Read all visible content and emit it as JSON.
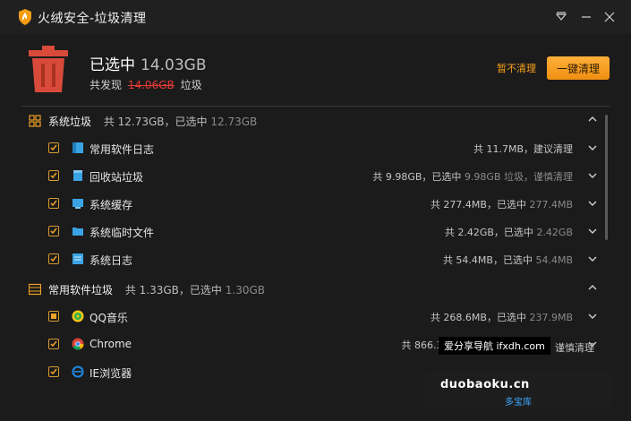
{
  "window": {
    "title": "火绒安全-垃圾清理",
    "buttons": [
      "dropdown-icon",
      "minimize-icon",
      "close-icon"
    ]
  },
  "summary": {
    "selected_prefix": "已选中",
    "selected_value": "14.03GB",
    "found_prefix": "共发现",
    "found_value": "14.06GB",
    "found_suffix": "垃圾",
    "cancel_label": "暂不清理",
    "clean_label": "一键清理"
  },
  "categories": [
    {
      "label": "系统垃圾",
      "summary": "共 12.73GB，已选中",
      "summary_hl": "12.73GB",
      "items": [
        {
          "label": "常用软件日志",
          "right": "共 11.7MB，建议清理",
          "hl": "",
          "checked": "full"
        },
        {
          "label": "回收站垃圾",
          "right": "共 9.98GB，已选中",
          "hl": "9.98GB 垃圾，谨慎清理",
          "checked": "full"
        },
        {
          "label": "系统缓存",
          "right": "共 277.4MB，已选中",
          "hl": "277.4MB",
          "checked": "full"
        },
        {
          "label": "系统临时文件",
          "right": "共 2.42GB，已选中",
          "hl": "2.42GB",
          "checked": "full"
        },
        {
          "label": "系统日志",
          "right": "共 54.4MB，已选中",
          "hl": "54.4MB",
          "checked": "full"
        }
      ]
    },
    {
      "label": "常用软件垃圾",
      "summary": "共 1.33GB，已选中",
      "summary_hl": "1.30GB",
      "items": [
        {
          "label": "QQ音乐",
          "right": "共 268.6MB，已选中",
          "hl": "237.9MB",
          "checked": "partial"
        },
        {
          "label": "Chrome",
          "right": "共 866.3M",
          "hl": "",
          "checked": "full"
        },
        {
          "label": "IE浏览器",
          "right": "",
          "hl": "",
          "checked": "full"
        }
      ]
    }
  ],
  "overlay": {
    "tag": "爱分享导航 ifxdh.com",
    "tag_tail": "谨慎清理"
  },
  "watermark": {
    "site": "duobaoku.cn",
    "sub": "多宝库"
  },
  "colors": {
    "accent": "#f6a01a",
    "warning_red": "#e53935",
    "background": "#1b1b1b"
  }
}
